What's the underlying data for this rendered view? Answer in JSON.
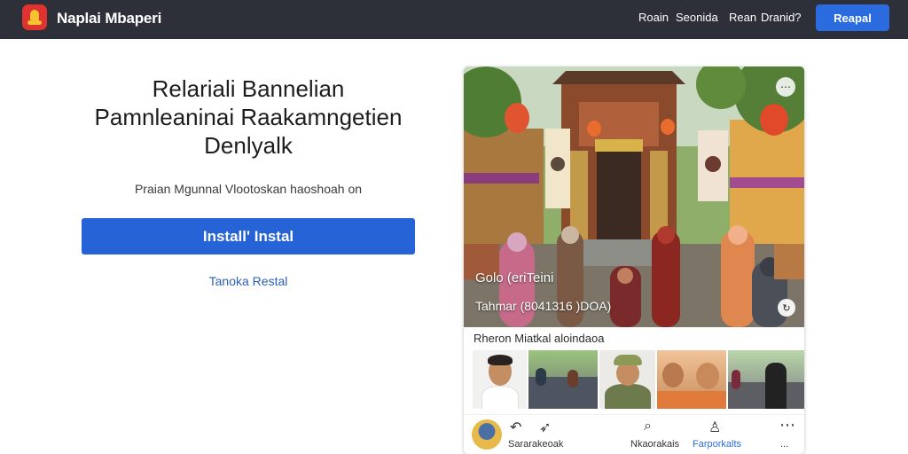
{
  "header": {
    "app_title": "Naplai Mbaperi",
    "nav": [
      "Roain",
      "Seonida",
      "Rean",
      "Dranid?"
    ],
    "cta": "Reapal"
  },
  "hero": {
    "title_lines": [
      "Relariali Bannelian",
      "Pamnleaninai Raakamngetien",
      "Denlyalk"
    ],
    "subtitle": "Praian Mgunnal Vlootoskan haoshoah on",
    "install_button": "Install' Instal",
    "secondary_link": "Tanoka Restal"
  },
  "card": {
    "photo_caption_1": "Golo (eriTeini",
    "photo_caption_2": "Tahmar (8041316 )DOA)",
    "photo_corner_icon": "dots-icon",
    "photo_play_icon": "replay-icon",
    "section_label": "Rheron Miatkal aloindaoa",
    "thumbnails": [
      "man-portrait",
      "crowd-street",
      "man-green-hat",
      "family-eating",
      "street-procession"
    ],
    "bottom_nav": {
      "left_label": "Sararakeoak",
      "search_label": "Nkaorakais",
      "active_label": "Farporkalts",
      "more_label": "..."
    },
    "colors": {
      "accent": "#2563d6",
      "topbar": "#2d3038",
      "link": "#2b5fb8"
    }
  }
}
